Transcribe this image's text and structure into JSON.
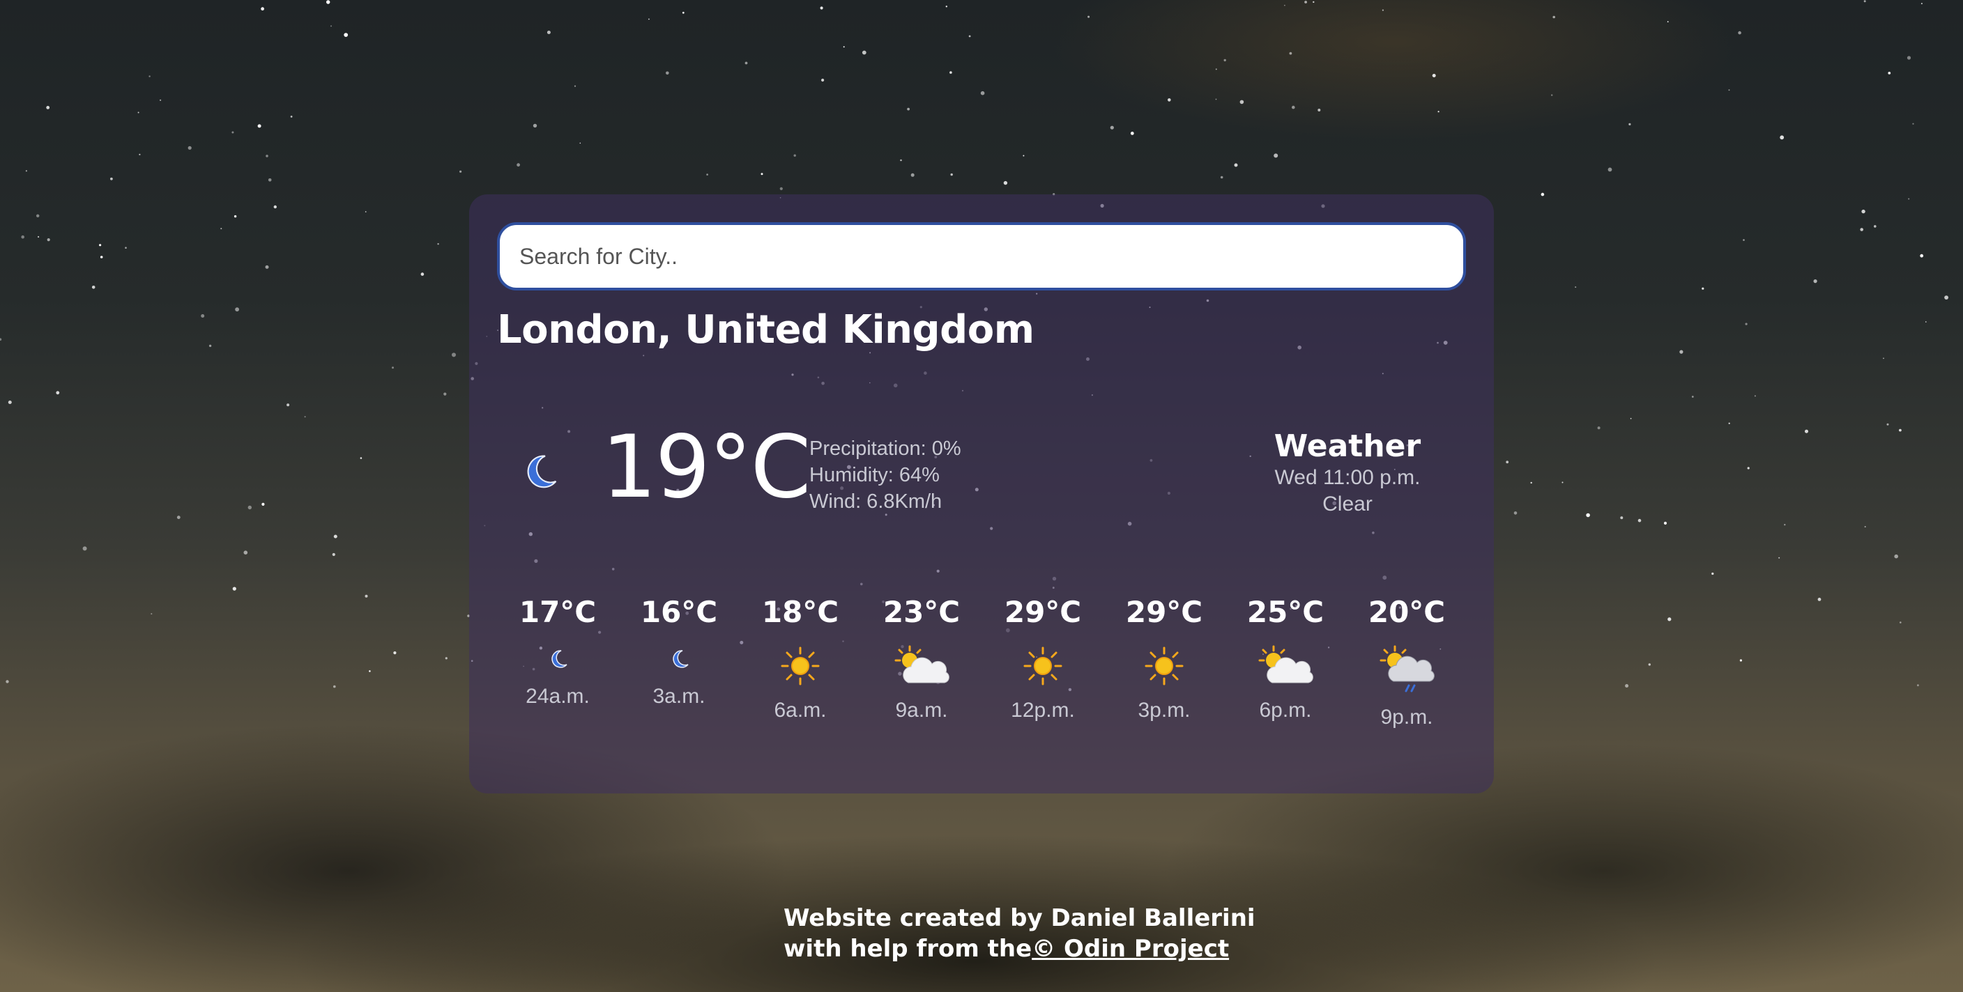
{
  "search": {
    "placeholder": "Search for City..",
    "value": ""
  },
  "location": "London, United Kingdom",
  "current": {
    "icon": "moon-icon",
    "temperature": "19°C",
    "precipitation": "Precipitation: 0%",
    "humidity": "Humidity: 64%",
    "wind": "Wind: 6.8Km/h",
    "summary_title": "Weather",
    "datetime": "Wed 11:00 p.m.",
    "condition": "Clear"
  },
  "forecast": [
    {
      "temp": "17°C",
      "icon": "moon-icon",
      "time": "24a.m."
    },
    {
      "temp": "16°C",
      "icon": "moon-icon",
      "time": "3a.m."
    },
    {
      "temp": "18°C",
      "icon": "sun-icon",
      "time": "6a.m."
    },
    {
      "temp": "23°C",
      "icon": "sun-cloud-icon",
      "time": "9a.m."
    },
    {
      "temp": "29°C",
      "icon": "sun-icon",
      "time": "12p.m."
    },
    {
      "temp": "29°C",
      "icon": "sun-icon",
      "time": "3p.m."
    },
    {
      "temp": "25°C",
      "icon": "sun-cloud-icon",
      "time": "6p.m."
    },
    {
      "temp": "20°C",
      "icon": "sun-cloud-rain-icon",
      "time": "9p.m."
    }
  ],
  "footer": {
    "line1": "Website created by Daniel Ballerini",
    "line2_prefix": "with help from the",
    "link_text": "© Odin Project"
  },
  "colors": {
    "card": "#3e305c",
    "search_border": "#2f4f9e",
    "moon": "#3b6fd8",
    "sun": "#f6b81c"
  }
}
